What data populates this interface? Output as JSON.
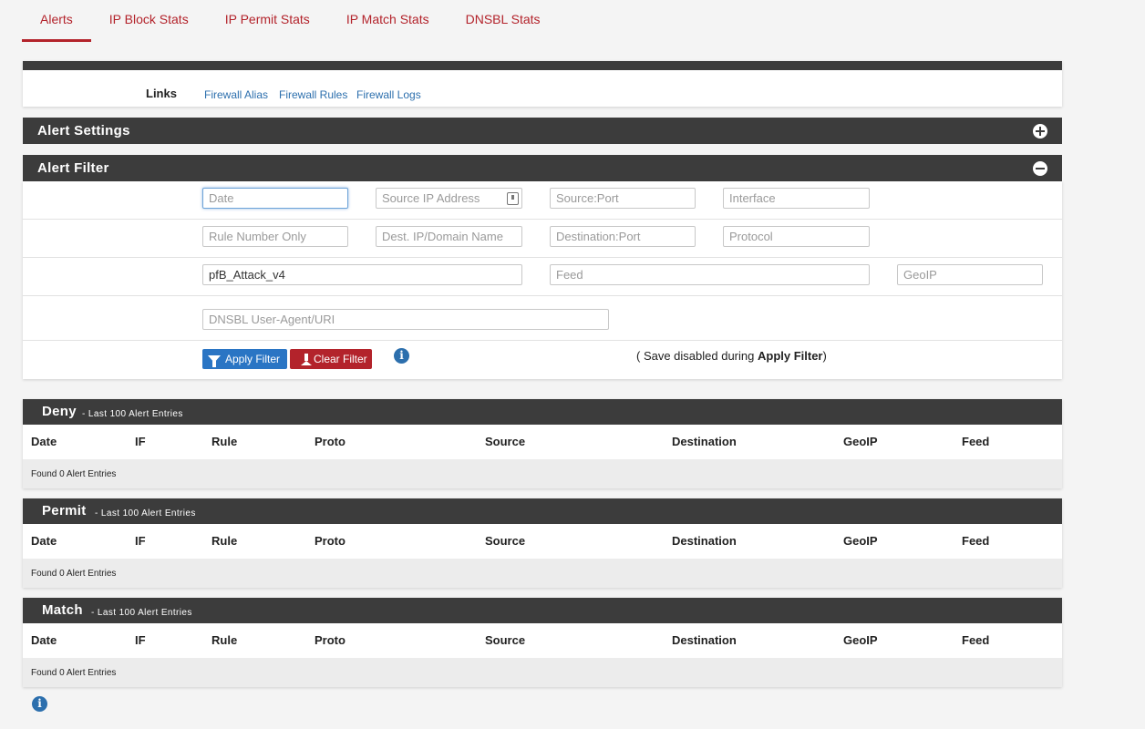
{
  "tabs": [
    "Alerts",
    "IP Block Stats",
    "IP Permit Stats",
    "IP Match Stats",
    "DNSBL Stats"
  ],
  "links": {
    "label": "Links",
    "items": [
      "Firewall Alias",
      "Firewall Rules",
      "Firewall Logs"
    ]
  },
  "alert_settings": {
    "title": "Alert Settings"
  },
  "alert_filter": {
    "title": "Alert Filter",
    "placeholders": {
      "date": "Date",
      "source_ip": "Source IP Address",
      "source_port": "Source:Port",
      "interface": "Interface",
      "rule_number": "Rule Number Only",
      "dest_ip": "Dest. IP/Domain Name",
      "dest_port": "Destination:Port",
      "protocol": "Protocol",
      "feed": "Feed",
      "geoip": "GeoIP",
      "dnsbl": "DNSBL User-Agent/URI"
    },
    "values": {
      "alias": "pfB_Attack_v4"
    },
    "apply_label": "Apply Filter",
    "clear_label": "Clear Filter",
    "save_note_prefix": "( Save disabled during ",
    "save_note_bold": "Apply Filter",
    "save_note_suffix": ")"
  },
  "columns": [
    "Date",
    "IF",
    "Rule",
    "Proto",
    "Source",
    "Destination",
    "GeoIP",
    "Feed"
  ],
  "sections": [
    {
      "name": "Deny",
      "subtitle": "- Last 100 Alert Entries",
      "found": "Found 0 Alert Entries"
    },
    {
      "name": "Permit",
      "subtitle": "- Last 100 Alert Entries",
      "found": "Found 0 Alert Entries"
    },
    {
      "name": "Match",
      "subtitle": "- Last 100 Alert Entries",
      "found": "Found 0 Alert Entries"
    }
  ],
  "icons": {
    "info": "info-icon",
    "expand": "plus-circle-icon",
    "collapse": "minus-circle-icon",
    "filter": "funnel-icon",
    "clear": "eraser-icon",
    "card": "contact-card-icon"
  },
  "colors": {
    "accent": "#b3232b",
    "header": "#3c3c3c",
    "link": "#2c6fad",
    "primary_button": "#2a75c4"
  }
}
